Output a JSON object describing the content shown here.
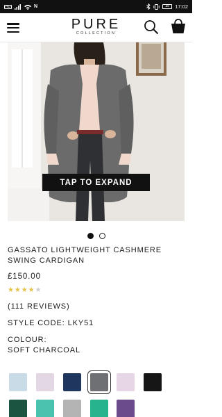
{
  "status_bar": {
    "sim_label": "HD",
    "time": "17:02",
    "battery": "35"
  },
  "header": {
    "logo_main": "PURE",
    "logo_sub": "COLLECTION"
  },
  "gallery": {
    "expand_label": "TAP TO EXPAND",
    "active_index": 0,
    "dots": 2
  },
  "product": {
    "title": "GASSATO LIGHTWEIGHT CASHMERE SWING CARDIGAN",
    "price": "£150.00",
    "rating": 4,
    "rating_max": 5,
    "reviews": "(111 REVIEWS)",
    "style_code": "STYLE CODE: LKY51",
    "colour_label": "COLOUR:",
    "colour_value": "SOFT CHARCOAL"
  },
  "swatches": [
    {
      "color": "#c9dbe6",
      "selected": false
    },
    {
      "color": "#e3d7e3",
      "selected": false
    },
    {
      "color": "#1f365e",
      "selected": false
    },
    {
      "color": "#6e7074",
      "selected": true
    },
    {
      "color": "#e6d6e6",
      "selected": false
    },
    {
      "color": "#161616",
      "selected": false
    },
    {
      "color": "#1b5440",
      "selected": false
    },
    {
      "color": "#49c3b0",
      "selected": false
    },
    {
      "color": "#b4b4b4",
      "selected": false
    },
    {
      "color": "#27b48c",
      "selected": false
    },
    {
      "color": "#6c4b8c",
      "selected": false
    }
  ]
}
